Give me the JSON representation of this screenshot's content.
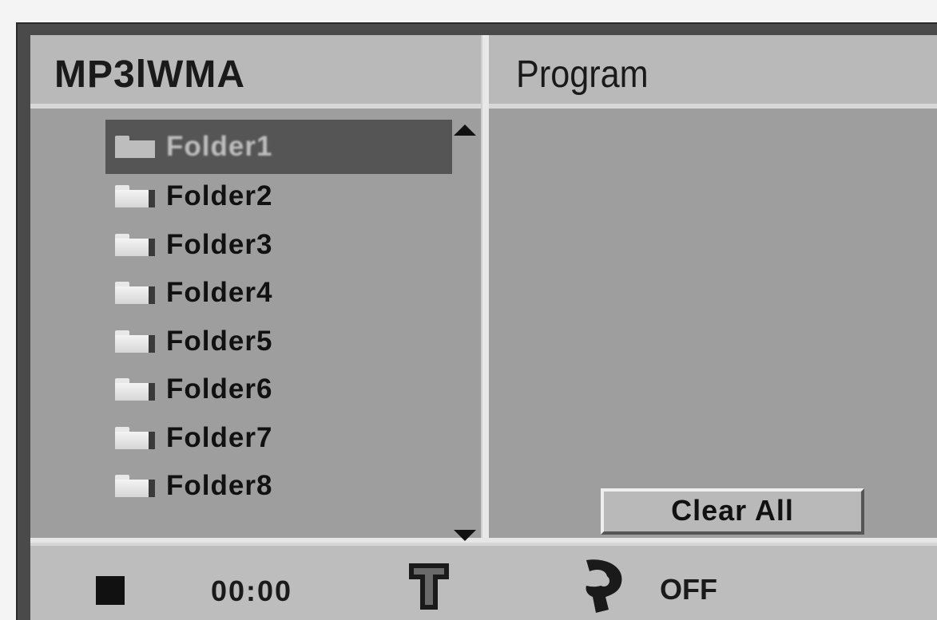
{
  "header": {
    "left_title": "MP3lWMA",
    "right_title": "Program"
  },
  "folders": [
    {
      "label": "Folder1",
      "selected": true
    },
    {
      "label": "Folder2",
      "selected": false
    },
    {
      "label": "Folder3",
      "selected": false
    },
    {
      "label": "Folder4",
      "selected": false
    },
    {
      "label": "Folder5",
      "selected": false
    },
    {
      "label": "Folder6",
      "selected": false
    },
    {
      "label": "Folder7",
      "selected": false
    },
    {
      "label": "Folder8",
      "selected": false
    }
  ],
  "program": {
    "clear_all_label": "Clear All"
  },
  "status": {
    "playback_icon": "stop-icon",
    "time": "00:00",
    "title_icon": "t-icon",
    "repeat_icon": "repeat-icon",
    "repeat_state": "OFF"
  },
  "colors": {
    "panel_bg": "#9e9e9e",
    "header_bg": "#b9b9b9",
    "selected_bg": "#555555"
  }
}
